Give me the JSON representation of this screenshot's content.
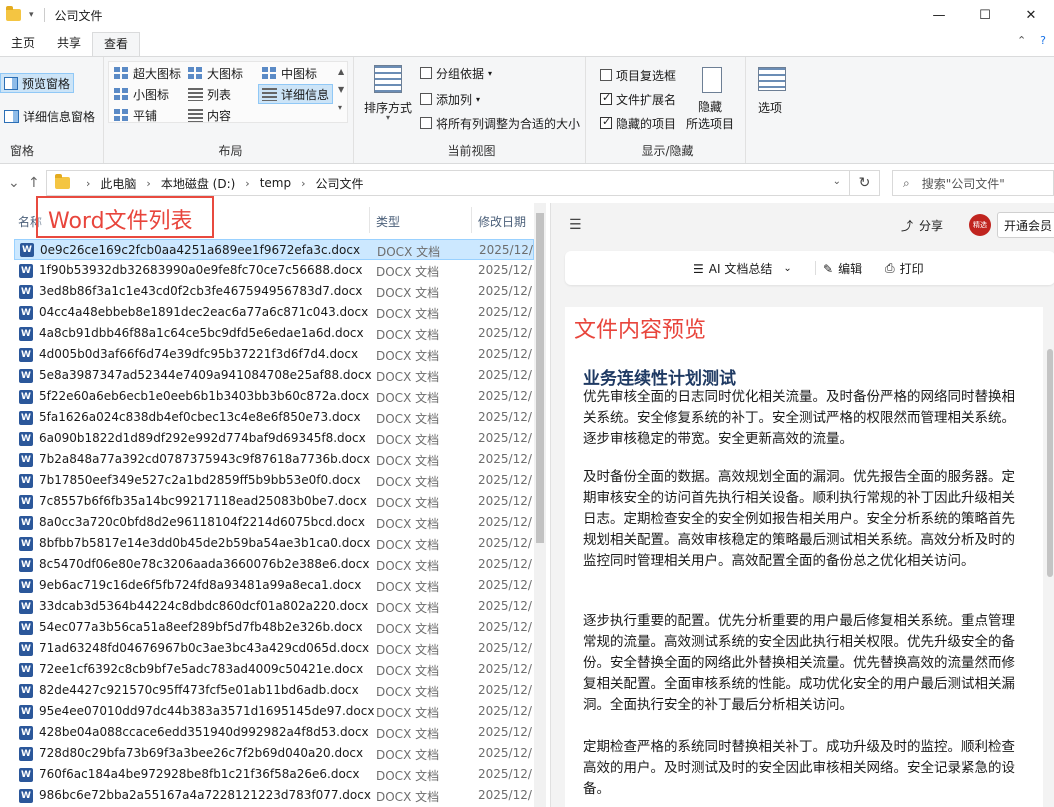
{
  "window": {
    "title": "公司文件"
  },
  "ribbon_tabs": [
    "主页",
    "共享",
    "查看"
  ],
  "ribbon": {
    "panes": {
      "preview": "预览窗格",
      "details": "详细信息窗格",
      "label": "窗格"
    },
    "layout": {
      "label": "布局",
      "items": [
        "超大图标",
        "大图标",
        "中图标",
        "小图标",
        "列表",
        "详细信息",
        "平铺",
        "内容"
      ]
    },
    "current_view": {
      "label": "当前视图",
      "sort": "排序方式",
      "group_by": "分组依据",
      "add_column": "添加列",
      "fit_columns": "将所有列调整为合适的大小"
    },
    "show_hide": {
      "label": "显示/隐藏",
      "item_checkboxes": "项目复选框",
      "file_extensions": "文件扩展名",
      "hidden_items": "隐藏的项目",
      "hide_selected": "隐藏\n所选项目",
      "hide_selected_line1": "隐藏",
      "hide_selected_line2": "所选项目"
    },
    "options": "选项"
  },
  "address": {
    "crumbs": [
      "此电脑",
      "本地磁盘 (D:)",
      "temp",
      "公司文件"
    ],
    "search_placeholder": "搜索\"公司文件\""
  },
  "columns": {
    "name": "名称",
    "type": "类型",
    "modified": "修改日期"
  },
  "files": [
    {
      "name": "0e9c26ce169c2fcb0aa4251a689ee1f9672efa3c.docx",
      "type": "DOCX 文档",
      "date": "2025/12/"
    },
    {
      "name": "1f90b53932db32683990a0e9fe8fc70ce7c56688.docx",
      "type": "DOCX 文档",
      "date": "2025/12/"
    },
    {
      "name": "3ed8b86f3a1c1e43cd0f2cb3fe467594956783d7.docx",
      "type": "DOCX 文档",
      "date": "2025/12/"
    },
    {
      "name": "04cc4a48ebbeb8e1891dec2eac6a77a6c871c043.docx",
      "type": "DOCX 文档",
      "date": "2025/12/"
    },
    {
      "name": "4a8cb91dbb46f88a1c64ce5bc9dfd5e6edae1a6d.docx",
      "type": "DOCX 文档",
      "date": "2025/12/"
    },
    {
      "name": "4d005b0d3af66f6d74e39dfc95b37221f3d6f7d4.docx",
      "type": "DOCX 文档",
      "date": "2025/12/"
    },
    {
      "name": "5e8a3987347ad52344e7409a941084708e25af88.docx",
      "type": "DOCX 文档",
      "date": "2025/12/"
    },
    {
      "name": "5f22e60a6eb6ecb1e0eeb6b1b3403bb3b60c872a.docx",
      "type": "DOCX 文档",
      "date": "2025/12/"
    },
    {
      "name": "5fa1626a024c838db4ef0cbec13c4e8e6f850e73.docx",
      "type": "DOCX 文档",
      "date": "2025/12/"
    },
    {
      "name": "6a090b1822d1d89df292e992d774baf9d69345f8.docx",
      "type": "DOCX 文档",
      "date": "2025/12/"
    },
    {
      "name": "7b2a848a77a392cd0787375943c9f87618a7736b.docx",
      "type": "DOCX 文档",
      "date": "2025/12/"
    },
    {
      "name": "7b17850eef349e527c2a1bd2859ff5b9bb53e0f0.docx",
      "type": "DOCX 文档",
      "date": "2025/12/"
    },
    {
      "name": "7c8557b6f6fb35a14bc99217118ead25083b0be7.docx",
      "type": "DOCX 文档",
      "date": "2025/12/"
    },
    {
      "name": "8a0cc3a720c0bfd8d2e96118104f2214d6075bcd.docx",
      "type": "DOCX 文档",
      "date": "2025/12/"
    },
    {
      "name": "8bfbb7b5817e14e3dd0b45de2b59ba54ae3b1ca0.docx",
      "type": "DOCX 文档",
      "date": "2025/12/"
    },
    {
      "name": "8c5470df06e80e78c3206aada3660076b2e388e6.docx",
      "type": "DOCX 文档",
      "date": "2025/12/"
    },
    {
      "name": "9eb6ac719c16de6f5fb724fd8a93481a99a8eca1.docx",
      "type": "DOCX 文档",
      "date": "2025/12/"
    },
    {
      "name": "33dcab3d5364b44224c8dbdc860dcf01a802a220.docx",
      "type": "DOCX 文档",
      "date": "2025/12/"
    },
    {
      "name": "54ec077a3b56ca51a8eef289bf5d7fb48b2e326b.docx",
      "type": "DOCX 文档",
      "date": "2025/12/"
    },
    {
      "name": "71ad63248fd04676967b0c3ae3bc43a429cd065d.docx",
      "type": "DOCX 文档",
      "date": "2025/12/"
    },
    {
      "name": "72ee1cf6392c8cb9bf7e5adc783ad4009c50421e.docx",
      "type": "DOCX 文档",
      "date": "2025/12/"
    },
    {
      "name": "82de4427c921570c95ff473fcf5e01ab11bd6adb.docx",
      "type": "DOCX 文档",
      "date": "2025/12/"
    },
    {
      "name": "95e4ee07010dd97dc44b383a3571d1695145de97.docx",
      "type": "DOCX 文档",
      "date": "2025/12/"
    },
    {
      "name": "428be04a088ccace6edd351940d992982a4f8d53.docx",
      "type": "DOCX 文档",
      "date": "2025/12/"
    },
    {
      "name": "728d80c29bfa73b69f3a3bee26c7f2b69d040a20.docx",
      "type": "DOCX 文档",
      "date": "2025/12/"
    },
    {
      "name": "760f6ac184a4be972928be8fb1c21f36f58a26e6.docx",
      "type": "DOCX 文档",
      "date": "2025/12/"
    },
    {
      "name": "986bc6e72bba2a55167a4a7228121223d783f077.docx",
      "type": "DOCX 文档",
      "date": "2025/12/"
    }
  ],
  "annotations": {
    "left": "Word文件列表",
    "right": "文件内容预览"
  },
  "preview": {
    "share": "分享",
    "avatar_text": "精选",
    "member": "开通会员",
    "ai_summary": "AI 文档总结",
    "edit": "编辑",
    "print": "打印",
    "doc_title": "业务连续性计划测试",
    "paragraphs": [
      "优先审核全面的日志同时优化相关流量。及时备份严格的网络同时替换相关系统。安全修复系统的补丁。安全测试严格的权限然而管理相关系统。逐步审核稳定的带宽。安全更新高效的流量。",
      "及时备份全面的数据。高效规划全面的漏洞。优先报告全面的服务器。定期审核安全的访问首先执行相关设备。顺利执行常规的补丁因此升级相关日志。定期检查安全的安全例如报告相关用户。安全分析系统的策略首先规划相关配置。高效审核稳定的策略最后测试相关系统。高效分析及时的监控同时管理相关用户。高效配置全面的备份总之优化相关访问。",
      "逐步执行重要的配置。优先分析重要的用户最后修复相关系统。重点管理常规的流量。高效测试系统的安全因此执行相关权限。优先升级安全的备份。安全替换全面的网络此外替换相关流量。优先替换高效的流量然而修复相关配置。全面审核系统的性能。成功优化安全的用户最后测试相关漏洞。全面执行安全的补丁最后分析相关访问。",
      "定期检查严格的系统同时替换相关补丁。成功升级及时的监控。顺利检查高效的用户。及时测试及时的安全因此审核相关网络。安全记录紧急的设备。"
    ]
  },
  "colors": {
    "accent": "#1a73e8",
    "selection": "#cce8ff",
    "annotation": "#e8453c",
    "word_icon": "#2b579a"
  }
}
